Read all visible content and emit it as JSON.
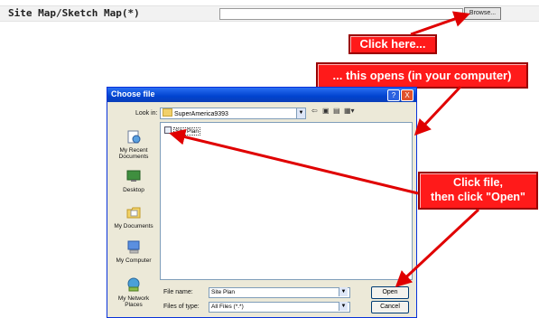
{
  "form_row": {
    "field_label": "Site Map/Sketch Map(*)",
    "browse_label": "Browse..."
  },
  "callouts": {
    "click_here": "Click here...",
    "opens": "... this opens (in your computer)",
    "click_file_line1": "Click file,",
    "click_file_line2": "then click \"Open\"",
    "color": "#ff1a1a"
  },
  "dialog": {
    "title": "Choose file",
    "help_icon": "?",
    "close_icon": "X",
    "look_in_label": "Look in:",
    "look_in_value": "SuperAmerica9393",
    "toolbar_icons": [
      "back-icon",
      "up-folder-icon",
      "new-folder-icon",
      "views-icon"
    ],
    "places": [
      {
        "label": "My Recent Documents",
        "icon": "recent-documents-icon"
      },
      {
        "label": "Desktop",
        "icon": "desktop-icon"
      },
      {
        "label": "My Documents",
        "icon": "my-documents-icon"
      },
      {
        "label": "My Computer",
        "icon": "my-computer-icon"
      },
      {
        "label": "My Network Places",
        "icon": "network-places-icon"
      }
    ],
    "files": [
      {
        "name": "Site Plan"
      }
    ],
    "file_name_label": "File name:",
    "file_name_value": "Site Plan",
    "files_of_type_label": "Files of type:",
    "files_of_type_value": "All Files (*.*)",
    "open_label": "Open",
    "cancel_label": "Cancel"
  }
}
